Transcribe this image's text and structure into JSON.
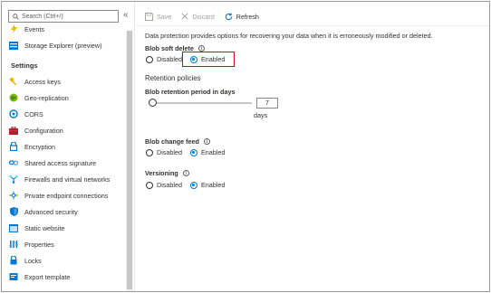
{
  "sidebar": {
    "search_placeholder": "Search (Ctrl+/)",
    "collapse_glyph": "«",
    "top_items": [
      {
        "label": "Events",
        "icon": "lightning-icon"
      },
      {
        "label": "Storage Explorer (preview)",
        "icon": "storage-explorer-icon"
      }
    ],
    "settings_title": "Settings",
    "settings_items": [
      {
        "label": "Access keys",
        "icon": "key-icon"
      },
      {
        "label": "Geo-replication",
        "icon": "globe-icon"
      },
      {
        "label": "CORS",
        "icon": "cors-icon"
      },
      {
        "label": "Configuration",
        "icon": "toolbox-icon"
      },
      {
        "label": "Encryption",
        "icon": "lock-icon"
      },
      {
        "label": "Shared access signature",
        "icon": "link-icon"
      },
      {
        "label": "Firewalls and virtual networks",
        "icon": "network-icon"
      },
      {
        "label": "Private endpoint connections",
        "icon": "endpoint-icon"
      },
      {
        "label": "Advanced security",
        "icon": "shield-icon"
      },
      {
        "label": "Static website",
        "icon": "website-icon"
      },
      {
        "label": "Properties",
        "icon": "properties-icon"
      },
      {
        "label": "Locks",
        "icon": "lock-icon"
      },
      {
        "label": "Export template",
        "icon": "export-template-icon"
      }
    ]
  },
  "toolbar": {
    "save_label": "Save",
    "discard_label": "Discard",
    "refresh_label": "Refresh"
  },
  "main": {
    "description": "Data protection provides options for recovering your data when it is erroneously modified or deleted.",
    "soft_delete": {
      "label": "Blob soft delete",
      "info": "i",
      "options": [
        "Disabled",
        "Enabled"
      ],
      "selected": "Enabled"
    },
    "retention_title": "Retention policies",
    "retention": {
      "label": "Blob retention period in days",
      "value": "7",
      "unit": "days"
    },
    "change_feed": {
      "label": "Blob change feed",
      "info": "i",
      "options": [
        "Disabled",
        "Enabled"
      ],
      "selected": "Enabled"
    },
    "versioning": {
      "label": "Versioning",
      "info": "i",
      "options": [
        "Disabled",
        "Enabled"
      ],
      "selected": "Enabled"
    }
  },
  "colors": {
    "accent": "#0078d4",
    "highlight": "#c50f1f"
  }
}
